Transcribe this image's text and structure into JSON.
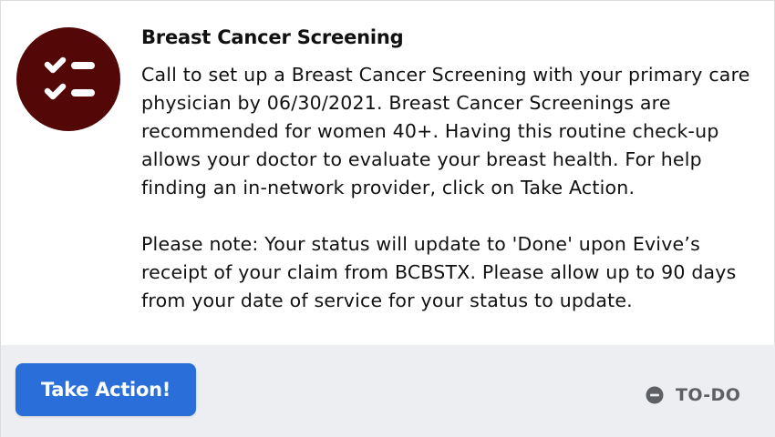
{
  "card": {
    "icon": "checklist-icon",
    "icon_bg_color": "#540707",
    "title": "Breast Cancer Screening",
    "paragraph_1": "Call to set up a Breast Cancer Screening with your primary care physician by 06/30/2021. Breast Cancer Screenings are recommended for women 40+. Having this routine check-up allows your doctor to evaluate your breast health. For help finding an in-network provider, click on Take Action.",
    "paragraph_2": "Please note: Your status will update to 'Done' upon Evive’s receipt of your claim from BCBSTX. Please allow up to 90 days from your date of service for your status to update."
  },
  "footer": {
    "action_label": "Take Action!",
    "action_color": "#2a6fd9",
    "status_icon": "minus-circle-icon",
    "status_label": "TO-DO"
  }
}
